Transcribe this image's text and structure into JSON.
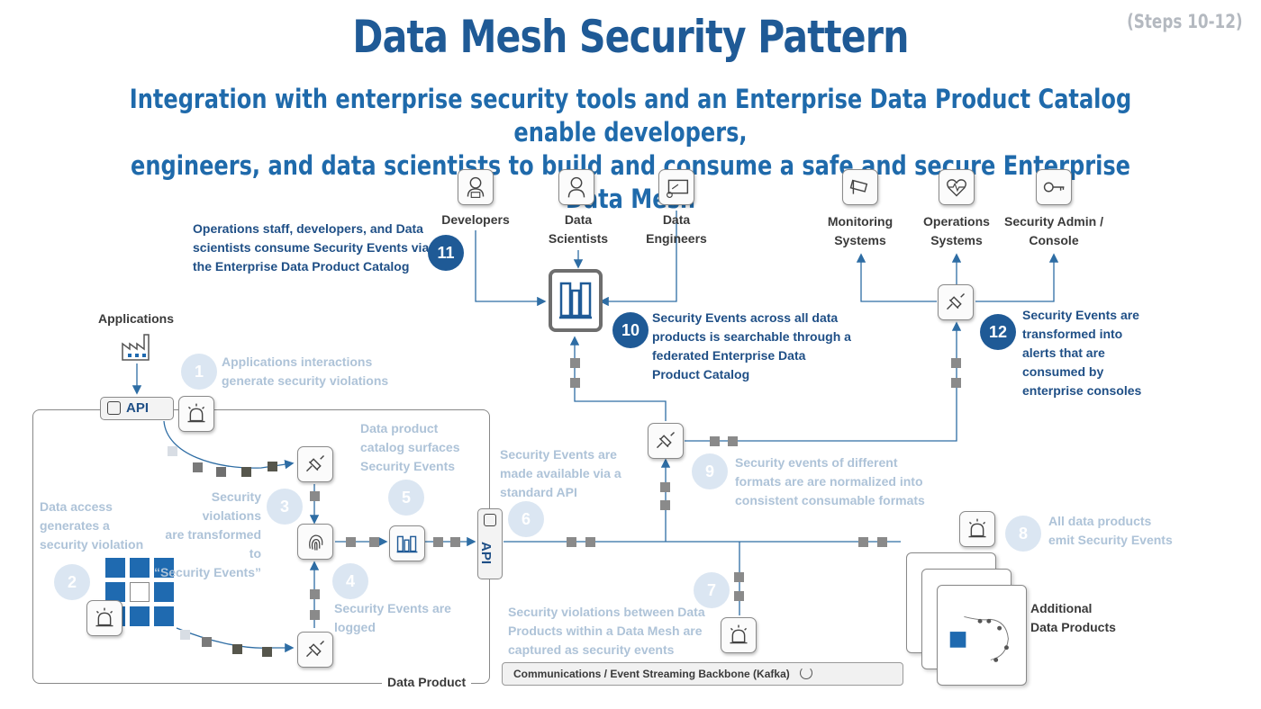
{
  "header": {
    "title": "Data Mesh Security Pattern",
    "steps": "(Steps 10-12)",
    "subtitle_line1": "Integration with enterprise security tools and an Enterprise Data Product Catalog enable developers,",
    "subtitle_line2": "engineers, and data scientists to build and consume a safe and secure Enterprise Data Mesh"
  },
  "consumers": {
    "developers": "Developers",
    "data_scientists_1": "Data",
    "data_scientists_2": "Scientists",
    "data_engineers_1": "Data",
    "data_engineers_2": "Engineers"
  },
  "systems": {
    "monitoring_1": "Monitoring",
    "monitoring_2": "Systems",
    "operations_1": "Operations",
    "operations_2": "Systems",
    "admin_1": "Security Admin /",
    "admin_2": "Console"
  },
  "steps": {
    "s1": {
      "num": "1",
      "line1": "Applications interactions",
      "line2": "generate security violations"
    },
    "s2": {
      "num": "2",
      "line1": "Data access",
      "line2": "generates a",
      "line3": "security violation"
    },
    "s3": {
      "num": "3",
      "line1": "Security violations",
      "line2": "are transformed to",
      "line3": "“Security Events”"
    },
    "s4": {
      "num": "4",
      "line1": "Security Events are",
      "line2": "logged"
    },
    "s5": {
      "num": "5",
      "line1": "Data product",
      "line2": "catalog surfaces",
      "line3": "Security Events"
    },
    "s6": {
      "num": "6",
      "line1": "Security Events are",
      "line2": "made available via a",
      "line3": "standard API"
    },
    "s7": {
      "num": "7",
      "line1": "Security violations between Data",
      "line2": "Products within a Data Mesh are",
      "line3": "captured as security events"
    },
    "s8": {
      "num": "8",
      "line1": "All data products",
      "line2": "emit Security Events"
    },
    "s9": {
      "num": "9",
      "line1": "Security events of different",
      "line2": "formats are are normalized into",
      "line3": "consistent  consumable formats"
    },
    "s10": {
      "num": "10",
      "line1": "Security Events across all data",
      "line2": "products is searchable through a",
      "line3": "federated Enterprise Data",
      "line4": "Product Catalog"
    },
    "s11": {
      "num": "11",
      "line1": "Operations staff, developers, and Data",
      "line2": "scientists consume Security Events via",
      "line3": "the Enterprise Data Product Catalog"
    },
    "s12": {
      "num": "12",
      "line1": "Security Events are",
      "line2": "transformed into",
      "line3": "alerts that are",
      "line4": "consumed by",
      "line5": "enterprise consoles"
    }
  },
  "labels": {
    "applications": "Applications",
    "api": "API",
    "data_product": "Data Product",
    "kafka": "Communications / Event Streaming Backbone (Kafka)",
    "additional_1": "Additional",
    "additional_2": "Data Products"
  },
  "colors": {
    "title": "#1f5a96",
    "accent": "#1f6aab",
    "step_active": "#1f5a96",
    "step_faded": "#aec3d8",
    "line": "#2e6da4"
  }
}
